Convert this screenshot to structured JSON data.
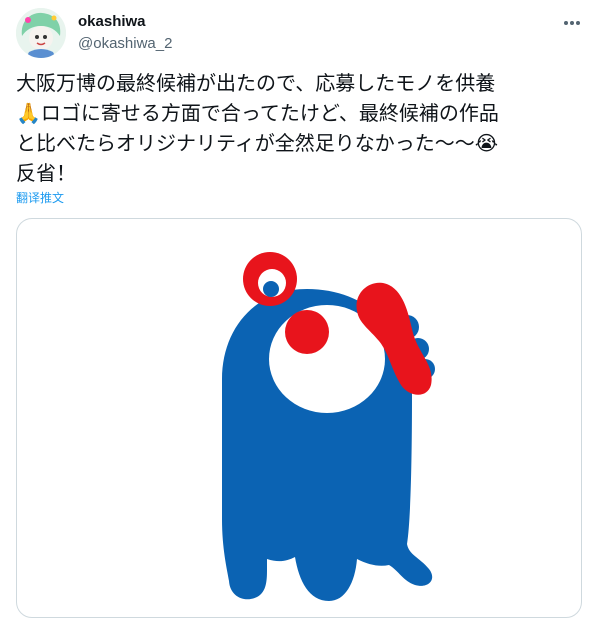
{
  "tweet": {
    "display_name": "okashiwa",
    "handle": "@okashiwa_2",
    "text_lines": [
      "大阪万博の最終候補が出たので、応募したモノを供養",
      "🙏ロゴに寄せる方面で合ってたけど、最終候補の作品",
      "と比べたらオリジナリティが全然足りなかった〜〜😭",
      "反省！"
    ],
    "translate_label": "翻译推文",
    "icons": {
      "more": "more-dots-icon",
      "avatar": "avatar-illustration"
    },
    "colors": {
      "mascot_blue": "#0b63b3",
      "mascot_red": "#e8141c",
      "link": "#1d9bf0",
      "secondary_text": "#536471"
    }
  }
}
